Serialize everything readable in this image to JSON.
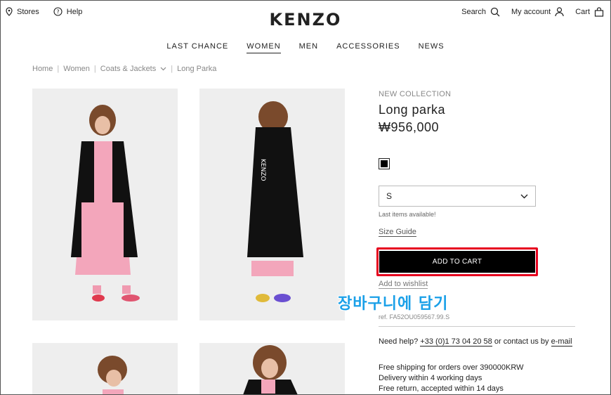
{
  "header": {
    "stores_label": "Stores",
    "help_label": "Help",
    "search_label": "Search",
    "account_label": "My account",
    "cart_label": "Cart",
    "logo": "KENZO"
  },
  "nav": {
    "items": [
      "LAST CHANCE",
      "WOMEN",
      "MEN",
      "ACCESSORIES",
      "NEWS"
    ],
    "active": "WOMEN"
  },
  "breadcrumb": [
    "Home",
    "Women",
    "Coats & Jackets",
    "Long Parka"
  ],
  "product": {
    "collection": "NEW COLLECTION",
    "name": "Long parka",
    "price": "₩956,000",
    "color_swatch": "#000000",
    "size_selected": "S",
    "stock_note": "Last items available!",
    "size_guide": "Size Guide",
    "add_to_cart": "ADD TO CART",
    "wishlist": "Add to wishlist",
    "reference": "ref. FA52OU059567.99.S"
  },
  "annotation": {
    "text": "장바구니에 담기",
    "color": "#1aa0e8",
    "highlight_color": "#e6001e"
  },
  "help": {
    "prefix": "Need help?",
    "phone": "+33 (0)1 73 04 20 58",
    "middle": "or contact us by",
    "email": "e-mail"
  },
  "shipping": [
    "Free shipping for orders over 390000KRW",
    "Delivery within 4 working days",
    "Free return, accepted within 14 days"
  ]
}
